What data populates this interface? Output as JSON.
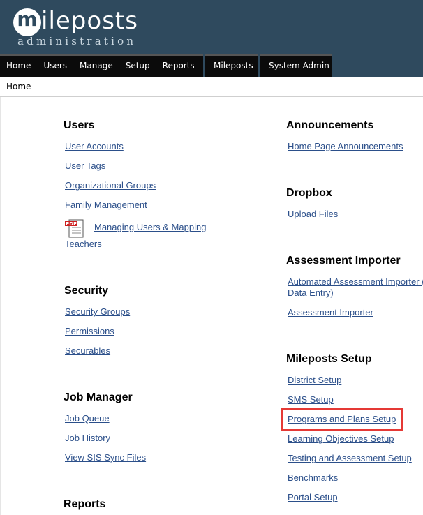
{
  "logo": {
    "letter": "m",
    "word": "ileposts",
    "sub": "administration"
  },
  "nav": {
    "group1": [
      "Home",
      "Users",
      "Manage",
      "Setup",
      "Reports"
    ],
    "group2": [
      "Mileposts"
    ],
    "group3": [
      "System Admin"
    ]
  },
  "breadcrumb": "Home",
  "sections": {
    "users": {
      "title": "Users",
      "links": [
        "User Accounts",
        "User Tags",
        "Organizational Groups",
        "Family Management"
      ],
      "pdf_link_line1": "Managing Users & Mapping",
      "pdf_link_line2": "Teachers"
    },
    "security": {
      "title": "Security",
      "links": [
        "Security Groups",
        "Permissions",
        "Securables"
      ]
    },
    "job_manager": {
      "title": "Job Manager",
      "links": [
        "Job Queue",
        "Job History",
        "View SIS Sync Files"
      ]
    },
    "reports": {
      "title": "Reports"
    },
    "announcements": {
      "title": "Announcements",
      "links": [
        "Home Page Announcements"
      ]
    },
    "dropbox": {
      "title": "Dropbox",
      "links": [
        "Upload Files"
      ]
    },
    "assessment_importer": {
      "title": "Assessment Importer",
      "link1_line1": "Automated Assessment Importer (",
      "link1_line2": "Data Entry)",
      "link2": "Assessment Importer"
    },
    "mileposts_setup": {
      "title": "Mileposts Setup",
      "links": [
        "District Setup",
        "SMS Setup",
        "Programs and Plans Setup",
        "Learning Objectives Setup",
        "Testing and Assessment Setup",
        "Benchmarks",
        "Portal Setup"
      ]
    }
  },
  "colors": {
    "header": "#2f4a5e",
    "nav": "#0b0b0b",
    "link": "#2b4f8a",
    "highlight": "#e53935"
  }
}
